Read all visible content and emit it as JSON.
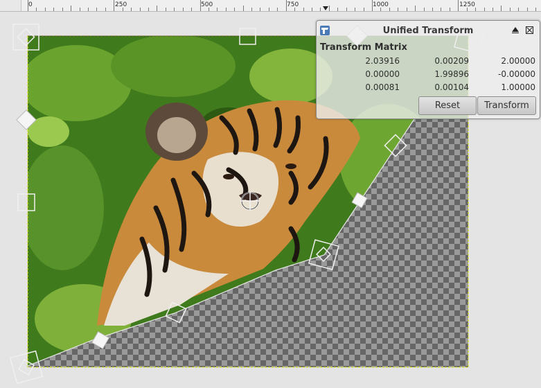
{
  "ruler": {
    "labels": [
      "0",
      "250",
      "500",
      "750",
      "1000",
      "1250"
    ],
    "values": [
      0,
      250,
      500,
      750,
      1000,
      1250
    ]
  },
  "dialog": {
    "title": "Unified Transform",
    "section_label": "Transform Matrix",
    "matrix": [
      [
        "2.03916",
        "0.00209",
        "2.00000"
      ],
      [
        "0.00000",
        "1.99896",
        "-0.00000"
      ],
      [
        "0.00081",
        "0.00104",
        "1.00000"
      ]
    ],
    "reset_label": "Reset",
    "transform_label": "Transform"
  },
  "icons": {
    "dialog_icon": "unified-transform-tool-icon",
    "collapse": "collapse-icon",
    "close": "close-icon",
    "pivot": "pivot-crosshair-icon"
  },
  "colors": {
    "canvas_bg": "#e4e4e4",
    "layer_boundary": "#e2e200",
    "checker_dark": "#666666",
    "checker_light": "#9a9a9a",
    "foliage": "#3f7a1c"
  }
}
